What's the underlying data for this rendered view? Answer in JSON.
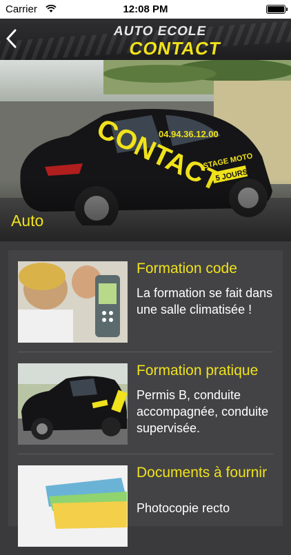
{
  "status_bar": {
    "carrier": "Carrier",
    "time": "12:08 PM"
  },
  "header": {
    "logo_line1": "AUTO ECOLE",
    "logo_line2": "CONTACT",
    "accent_color": "#f0e21b"
  },
  "hero": {
    "label": "Auto",
    "car_lettering": "CONTACT",
    "phone": "04.94.36.12.00",
    "badge_line1": "STAGE MOTO",
    "badge_line2": "5 JOURS"
  },
  "items": [
    {
      "title": "Formation code",
      "description": "La formation se fait dans une salle climatisée !",
      "thumb_icon": "students-with-remote-image"
    },
    {
      "title": "Formation pratique",
      "description": "Permis B, conduite accompagnée, conduite supervisée.",
      "thumb_icon": "driving-school-car-image"
    },
    {
      "title": "Documents à fournir",
      "description": "Photocopie recto",
      "thumb_icon": "document-folders-image"
    }
  ]
}
